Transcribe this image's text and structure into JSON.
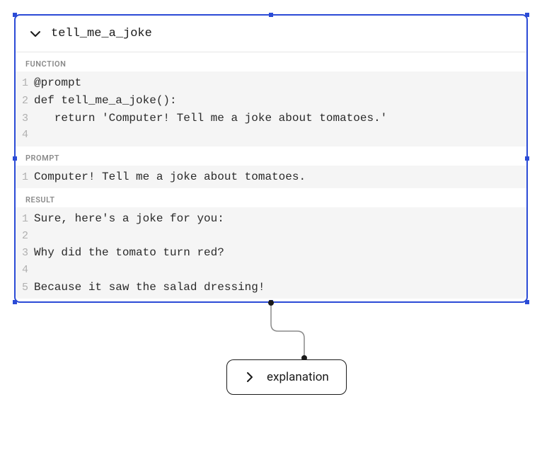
{
  "main": {
    "title": "tell_me_a_joke",
    "sections": {
      "function": {
        "label": "FUNCTION",
        "lines": [
          "@prompt",
          "def tell_me_a_joke():",
          "   return 'Computer! Tell me a joke about tomatoes.'",
          ""
        ]
      },
      "prompt": {
        "label": "PROMPT",
        "lines": [
          "Computer! Tell me a joke about tomatoes."
        ]
      },
      "result": {
        "label": "RESULT",
        "lines": [
          "Sure, here's a joke for you:",
          "",
          "Why did the tomato turn red?",
          "",
          "Because it saw the salad dressing!"
        ]
      }
    }
  },
  "explanation": {
    "title": "explanation"
  }
}
